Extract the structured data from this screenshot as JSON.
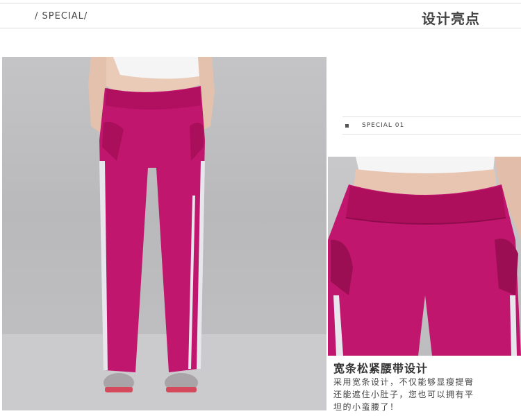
{
  "header": {
    "special_label": "/ SPECIAL/",
    "title": "设计亮点"
  },
  "section": {
    "label": "SPECIAL  01"
  },
  "feature": {
    "title": "宽条松紧腰带设计",
    "desc_line1": "采用宽条设计，不仅能够显瘦提臀",
    "desc_line2": "还能遮住小肚子，您也可以拥有平",
    "desc_line3": "坦的小蛮腰了！"
  },
  "colors": {
    "pants": "#c0166e",
    "stripe": "#e8e8ee",
    "skin": "#e8c7b4",
    "backdrop": "#bfbfc1"
  }
}
